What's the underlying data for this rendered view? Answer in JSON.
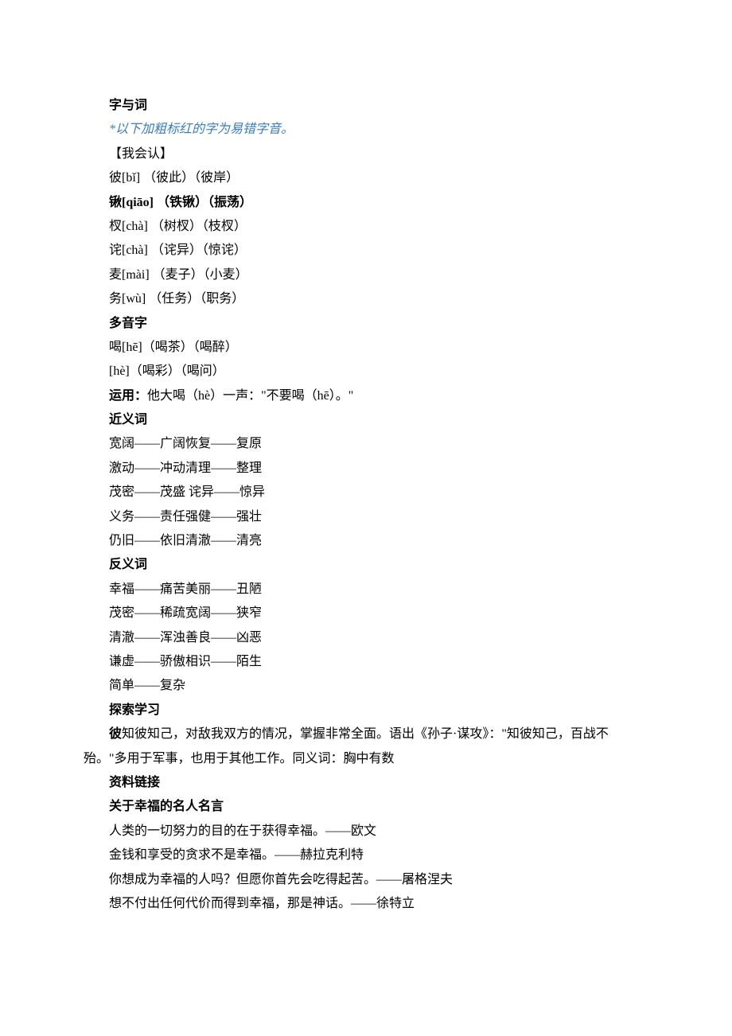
{
  "sections": {
    "title1": "字与词",
    "note": "*以下加粗标红的字为易错字音。",
    "heading_recognize": "【我会认】",
    "char_lines": [
      {
        "text": "彼[bǐ] （彼此）（彼岸）",
        "bold": false
      },
      {
        "text": "锹[qiāo] （铁锹）（振荡）",
        "bold": true
      },
      {
        "text": "杈[chà] （树杈）（枝杈）",
        "bold": false
      },
      {
        "text": "诧[chà] （诧异）（惊诧）",
        "bold": false
      },
      {
        "text": "麦[mài] （麦子）（小麦）",
        "bold": false
      },
      {
        "text": "务[wù] （任务）（职务）",
        "bold": false
      }
    ],
    "polyphonic_heading": "多音字",
    "polyphonic_lines": [
      "喝[hē]（喝茶）（喝醉）",
      "[hè]（喝彩）（喝问）"
    ],
    "usage_label": "运用：",
    "usage_text": "他大喝（hè）一声：\"不要喝（hē）。\"",
    "synonym_heading": "近义词",
    "synonym_lines": [
      "宽阔——广阔恢复——复原",
      "激动——冲动清理——整理",
      "茂密——茂盛  诧异——惊异",
      "义务——责任强健——强壮",
      "仍旧——依旧清澈——清亮"
    ],
    "antonym_heading": "反义词",
    "antonym_lines": [
      "幸福——痛苦美丽——丑陋",
      "茂密——稀疏宽阔——狭窄",
      "清澈——浑浊善良——凶恶",
      "谦虚——骄傲相识——陌生",
      "简单——复杂"
    ],
    "explore_heading": "探索学习",
    "explore_bold_lead": "彼",
    "explore_body": "知彼知己，对敌我双方的情况，掌握非常全面。语出《孙子·谋攻》：\"知彼知己，百战不殆。\"多用于军事，也用于其他工作。同义词：胸中有数",
    "resource_heading": "资料链接",
    "quotes_heading": "关于幸福的名人名言",
    "quotes": [
      "人类的一切努力的目的在于获得幸福。——欧文",
      "金钱和享受的贪求不是幸福。——赫拉克利特",
      "你想成为幸福的人吗？但愿你首先会吃得起苦。——屠格涅夫",
      "想不付出任何代价而得到幸福，那是神话。——徐特立"
    ]
  }
}
